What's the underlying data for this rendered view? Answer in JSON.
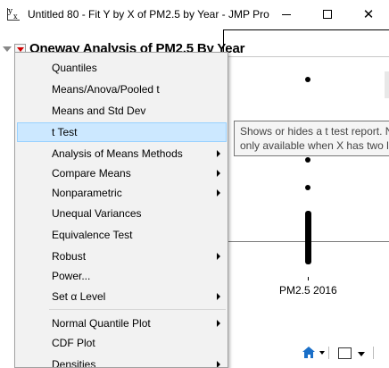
{
  "window": {
    "title": "Untitled 80 - Fit Y by X of PM2.5 by Year - JMP Pro",
    "icon": "jmp-fit-y-by-x-icon",
    "controls": {
      "minimize": "minimize-icon",
      "maximize": "maximize-icon",
      "close": "✕"
    }
  },
  "report": {
    "outline_title": "Oneway Analysis of PM2.5 By Year",
    "x_axis_label": "PM2.5 2016"
  },
  "tooltip": {
    "line1": "Shows or hides a t test report. N",
    "line2": "only available when X has two le"
  },
  "menu": {
    "items": [
      {
        "label": "Quantiles",
        "submenu": false
      },
      {
        "label": "Means/Anova/Pooled t",
        "submenu": false
      },
      {
        "label": "Means and Std Dev",
        "submenu": false
      },
      {
        "label": "t Test",
        "submenu": false,
        "highlighted": true
      },
      {
        "label": "Analysis of Means Methods",
        "submenu": true
      },
      {
        "label": "Compare Means",
        "submenu": true
      },
      {
        "label": "Nonparametric",
        "submenu": true
      },
      {
        "label": "Unequal Variances",
        "submenu": false
      },
      {
        "label": "Equivalence Test",
        "submenu": false
      },
      {
        "label": "Robust",
        "submenu": true
      },
      {
        "label": "Power...",
        "submenu": false
      },
      {
        "label": "Set α Level",
        "submenu": true
      },
      {
        "label": "Normal Quantile Plot",
        "submenu": true
      },
      {
        "label": "CDF Plot",
        "submenu": false
      },
      {
        "label": "Densities",
        "submenu": true
      }
    ]
  },
  "colors": {
    "highlight_bg": "#cce8ff",
    "highlight_border": "#99d1ff",
    "red_triangle": "#d00000",
    "home_icon": "#1a6fc8"
  }
}
